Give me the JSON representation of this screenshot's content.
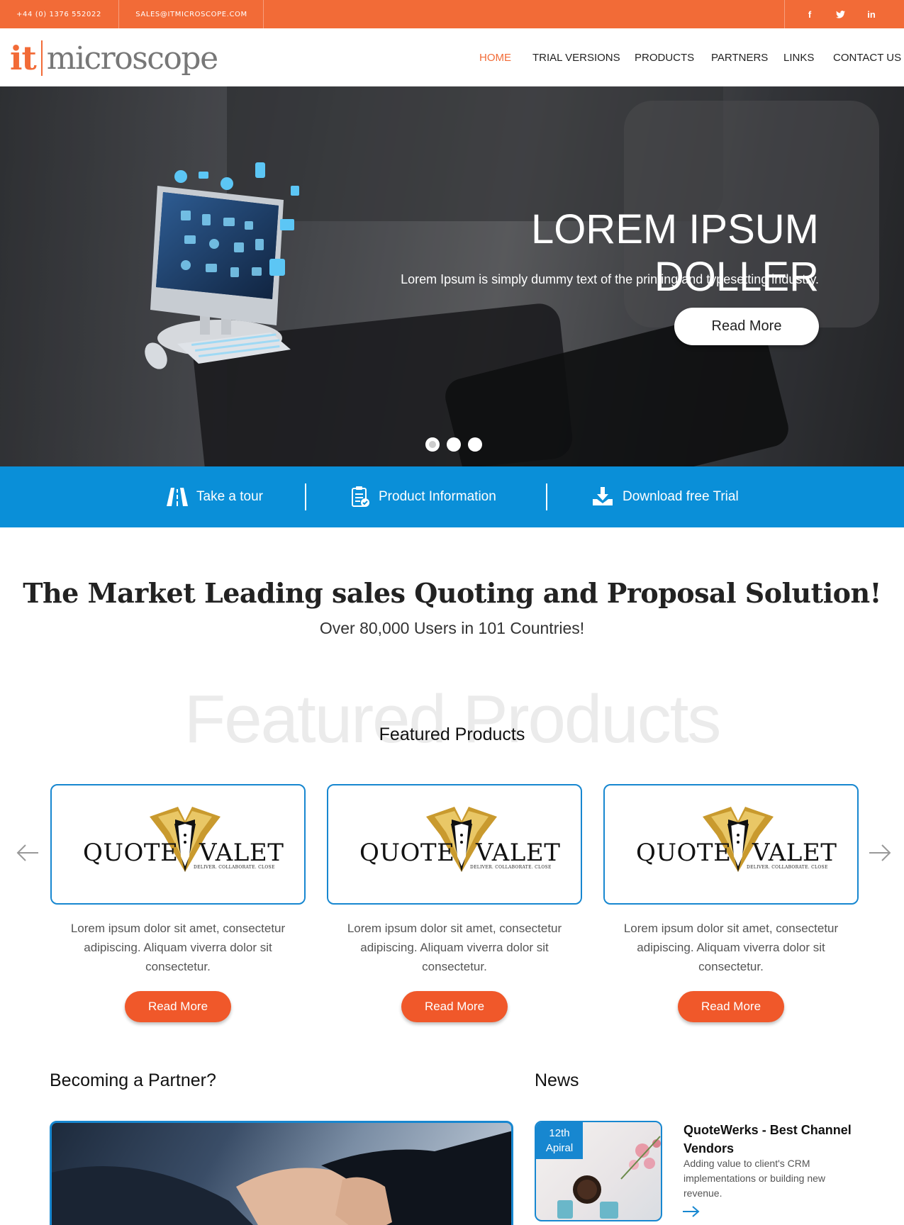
{
  "topbar": {
    "phone": "+44 (0) 1376 552022",
    "email": "SALES@ITMICROSCOPE.COM",
    "social": [
      "f",
      "t",
      "in"
    ]
  },
  "logo": {
    "part1": "it",
    "part2": "microscope"
  },
  "nav": {
    "items": [
      "HOME",
      "TRIAL VERSIONS",
      "PRODUCTS",
      "PARTNERS",
      "LINKS",
      "CONTACT US"
    ],
    "active": "HOME"
  },
  "hero": {
    "title": "LOREM IPSUM DOLLER",
    "subtitle": "Lorem Ipsum is simply dummy text of the printing and typesetting industry.",
    "button": "Read More"
  },
  "strip": {
    "items": [
      "Take a tour",
      "Product Information",
      "Download free Trial"
    ]
  },
  "intro": {
    "headline": "The Market Leading sales Quoting and Proposal Solution!",
    "subline": "Over 80,000 Users in 101 Countries!"
  },
  "featured": {
    "ghost": "Featured Products",
    "title": "Featured Products",
    "products": [
      {
        "logo_word1": "QUOTE",
        "logo_word2": "VALET",
        "tagline": "DELIVER. COLLABORATE. CLOSE",
        "text": "Lorem ipsum dolor sit amet, consectetur adipiscing. Aliquam viverra dolor sit consectetur.",
        "button": "Read More"
      },
      {
        "logo_word1": "QUOTE",
        "logo_word2": "VALET",
        "tagline": "DELIVER. COLLABORATE. CLOSE",
        "text": "Lorem ipsum dolor sit amet, consectetur adipiscing. Aliquam viverra dolor sit consectetur.",
        "button": "Read More"
      },
      {
        "logo_word1": "QUOTE",
        "logo_word2": "VALET",
        "tagline": "DELIVER. COLLABORATE. CLOSE",
        "text": "Lorem ipsum dolor sit amet, consectetur adipiscing. Aliquam viverra dolor sit consectetur.",
        "button": "Read More"
      }
    ]
  },
  "partner": {
    "title": "Becoming a Partner?"
  },
  "news": {
    "title": "News",
    "date_day": "12th",
    "date_month": "Apiral",
    "headline": "QuoteWerks - Best Channel Vendors",
    "body": "Adding value to client's CRM implementations or building new revenue."
  },
  "colors": {
    "accent": "#f26b37",
    "blue": "#0a8fd8",
    "button": "#f0582a"
  }
}
